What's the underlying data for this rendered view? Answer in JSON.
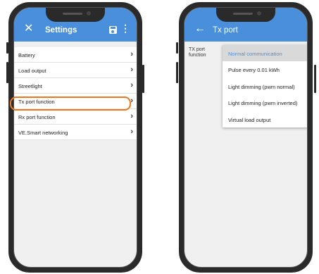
{
  "left_screen": {
    "appbar": {
      "nav_icon": "close-icon",
      "nav_glyph": "✕",
      "title": "Settings",
      "save_icon": "save-icon",
      "more_glyph": "⋮"
    },
    "items": [
      {
        "label": "Battery",
        "chevron": "›"
      },
      {
        "label": "Load output",
        "chevron": "›"
      },
      {
        "label": "Streetlight",
        "chevron": "›"
      },
      {
        "label": "Tx port function",
        "chevron": "›"
      },
      {
        "label": "Rx port function",
        "chevron": "›"
      },
      {
        "label": "VE.Smart networking",
        "chevron": "›"
      }
    ],
    "highlighted_item": "Tx port function"
  },
  "right_screen": {
    "appbar": {
      "nav_icon": "back-arrow-icon",
      "nav_glyph": "←",
      "title": "Tx port"
    },
    "field_label": "TX port function",
    "field_label_line1": "TX port",
    "field_label_line2": "function",
    "options": [
      {
        "label": "Normal communication",
        "selected": true
      },
      {
        "label": "Pulse every 0.01 kWh",
        "selected": false
      },
      {
        "label": "Light dimming (pwm normal)",
        "selected": false
      },
      {
        "label": "Light dimming (pwm inverted)",
        "selected": false
      },
      {
        "label": "Virtual load output",
        "selected": false
      }
    ]
  },
  "colors": {
    "appbar": "#4a8fdb",
    "highlight": "#e9781f",
    "background": "#f0f0f0"
  }
}
